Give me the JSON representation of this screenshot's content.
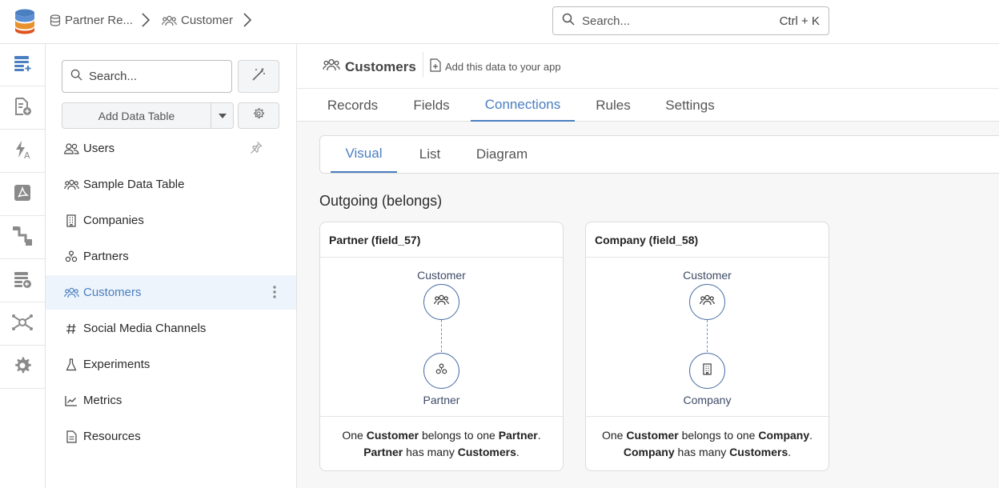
{
  "breadcrumb": {
    "app_label": "Partner Re...",
    "table_label": "Customer"
  },
  "global_search": {
    "placeholder": "Search...",
    "shortcut": "Ctrl + K"
  },
  "rail": {
    "items": [
      {
        "icon": "data-table-icon",
        "active": true
      },
      {
        "icon": "add-page-icon"
      },
      {
        "icon": "flash-text-icon"
      },
      {
        "icon": "pdf-icon"
      },
      {
        "icon": "flow-icon"
      },
      {
        "icon": "import-table-icon"
      },
      {
        "icon": "network-icon"
      },
      {
        "icon": "gear-icon"
      }
    ]
  },
  "sidebar": {
    "search_placeholder": "Search...",
    "add_table_label": "Add Data Table",
    "tables": [
      {
        "label": "Users",
        "icon": "users-icon"
      },
      {
        "label": "Sample Data Table",
        "icon": "group-icon"
      },
      {
        "label": "Companies",
        "icon": "building-icon"
      },
      {
        "label": "Partners",
        "icon": "partner-icon"
      },
      {
        "label": "Customers",
        "icon": "group-icon",
        "active": true
      },
      {
        "label": "Social Media Channels",
        "icon": "hash-icon"
      },
      {
        "label": "Experiments",
        "icon": "flask-icon"
      },
      {
        "label": "Metrics",
        "icon": "chart-line-icon"
      },
      {
        "label": "Resources",
        "icon": "document-icon"
      }
    ]
  },
  "main": {
    "title": "Customers",
    "add_to_app_label": "Add this data to your app",
    "tabs": [
      "Records",
      "Fields",
      "Connections",
      "Rules",
      "Settings"
    ],
    "active_tab": "Connections",
    "subtabs": [
      "Visual",
      "List",
      "Diagram"
    ],
    "active_subtab": "Visual",
    "section_title": "Outgoing (belongs)",
    "cards": [
      {
        "title": "Partner (field_57)",
        "from_label": "Customer",
        "to_label": "Partner",
        "to_icon": "partner-icon",
        "line1": {
          "a": "One ",
          "b": "Customer",
          "c": " belongs to one ",
          "d": "Partner",
          "e": "."
        },
        "line2": {
          "a": "Partner",
          "b": " has many ",
          "c": "Customers",
          "d": "."
        }
      },
      {
        "title": "Company (field_58)",
        "from_label": "Customer",
        "to_label": "Company",
        "to_icon": "building-icon",
        "line1": {
          "a": "One ",
          "b": "Customer",
          "c": " belongs to one ",
          "d": "Company",
          "e": "."
        },
        "line2": {
          "a": "Company",
          "b": " has many ",
          "c": "Customers",
          "d": "."
        }
      }
    ]
  },
  "colors": {
    "accent": "#4a7fc1",
    "node_border": "#4a6fa5",
    "active_bg": "#eef4fb"
  }
}
